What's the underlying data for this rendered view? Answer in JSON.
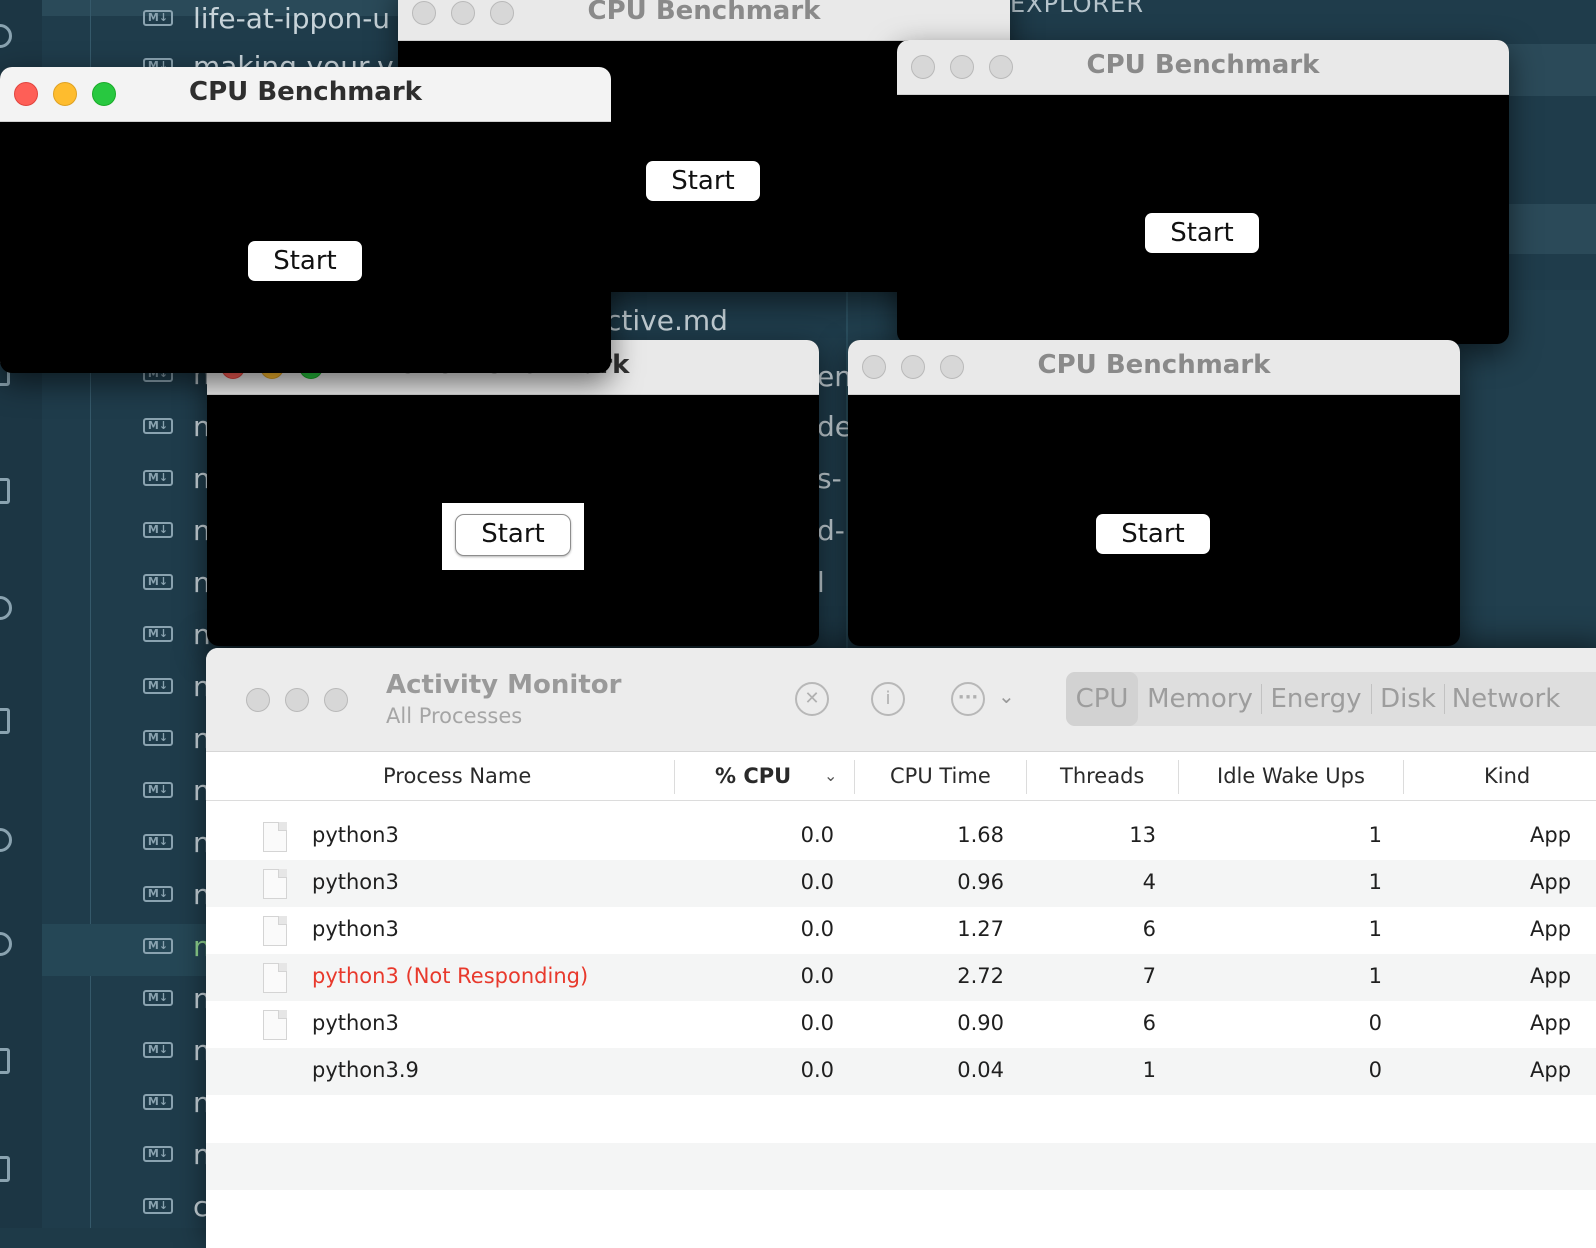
{
  "vscode": {
    "explorer_title": "EXPLORER",
    "top_rows": [
      "life-at-ippon-u",
      "making-your-v"
    ],
    "partial_file": "ctive.md",
    "md_badge": "M↓",
    "row_letter": "n",
    "active_row_letter": "n",
    "last_row_letter": "c",
    "right_fragments": [
      "en",
      "de",
      "s-",
      "d-",
      "l"
    ]
  },
  "benchmarks": [
    {
      "title": "CPU Benchmark",
      "button": "Start"
    },
    {
      "title": "CPU Benchmark",
      "button": "Start"
    },
    {
      "title": "CPU Benchmark",
      "button": "Start"
    },
    {
      "title": "CPU Benchmark",
      "button": "Start"
    },
    {
      "title": "CPU Benchmark",
      "button": "Start"
    }
  ],
  "activity_monitor": {
    "title": "Activity Monitor",
    "subtitle": "All Processes",
    "tabs": [
      "CPU",
      "Memory",
      "Energy",
      "Disk",
      "Network"
    ],
    "selected_tab": "CPU",
    "columns": [
      "Process Name",
      "% CPU",
      "CPU Time",
      "Threads",
      "Idle Wake Ups",
      "Kind"
    ],
    "sorted_column": "% CPU",
    "rows": [
      {
        "name": "python3",
        "cpu": "0.0",
        "time": "1.68",
        "threads": "13",
        "wake": "1",
        "kind": "App",
        "not_responding": false,
        "icon": "document-icon"
      },
      {
        "name": "python3",
        "cpu": "0.0",
        "time": "0.96",
        "threads": "4",
        "wake": "1",
        "kind": "App",
        "not_responding": false,
        "icon": "document-icon"
      },
      {
        "name": "python3",
        "cpu": "0.0",
        "time": "1.27",
        "threads": "6",
        "wake": "1",
        "kind": "App",
        "not_responding": false,
        "icon": "document-icon"
      },
      {
        "name": "python3 (Not Responding)",
        "cpu": "0.0",
        "time": "2.72",
        "threads": "7",
        "wake": "1",
        "kind": "App",
        "not_responding": true,
        "icon": "document-icon"
      },
      {
        "name": "python3",
        "cpu": "0.0",
        "time": "0.90",
        "threads": "6",
        "wake": "0",
        "kind": "App",
        "not_responding": false,
        "icon": "document-icon"
      },
      {
        "name": "python3.9",
        "cpu": "0.0",
        "time": "0.04",
        "threads": "1",
        "wake": "0",
        "kind": "App",
        "not_responding": false,
        "icon": ""
      }
    ],
    "colors": {
      "not_responding": "#e8392c"
    }
  }
}
